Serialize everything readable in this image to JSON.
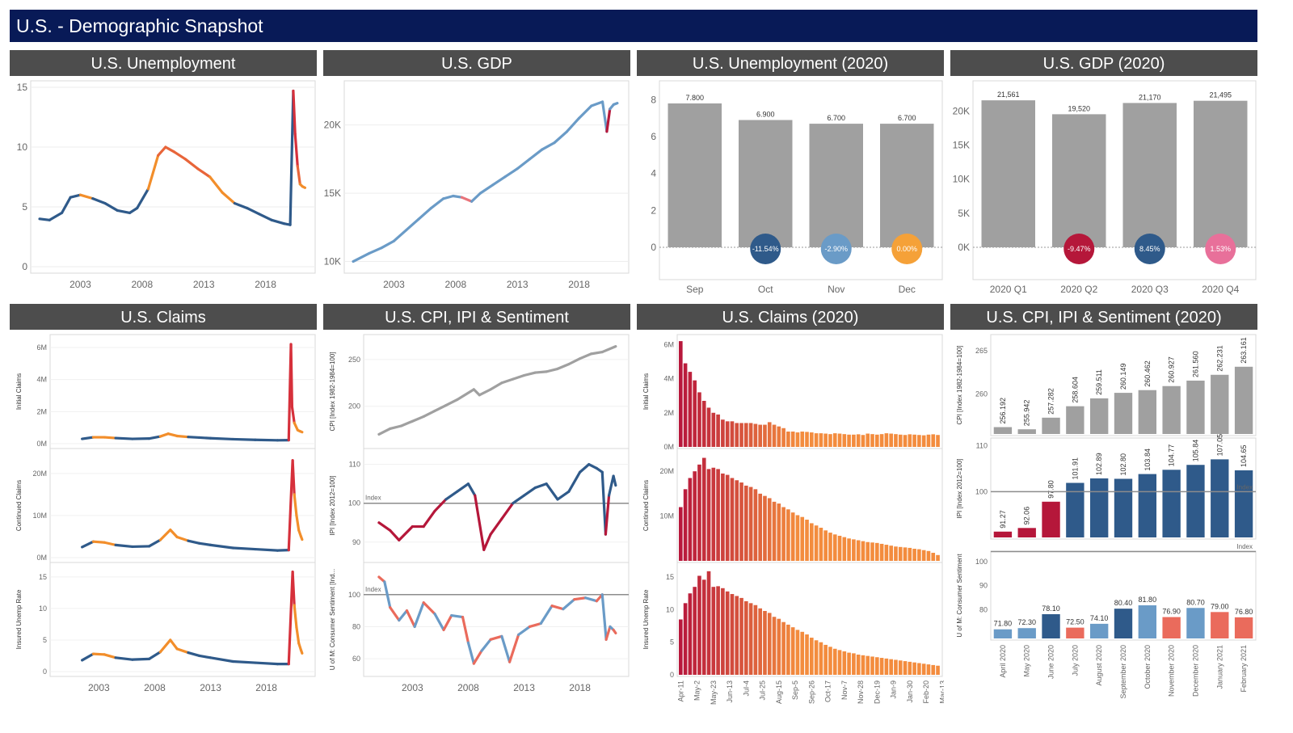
{
  "page_title": "U.S. - Demographic Snapshot",
  "colors": {
    "blue": "#2f5a8a",
    "orange": "#f28e2b",
    "red": "#d6303b",
    "crimson": "#b5173a",
    "grey": "#a0a0a0",
    "lightblue": "#6a9bc7",
    "salmon": "#ea6b5c",
    "pink": "#e8709a"
  },
  "panels": {
    "unemp": {
      "title": "U.S. Unemployment"
    },
    "gdp": {
      "title": "U.S. GDP"
    },
    "unemp2020": {
      "title": "U.S. Unemployment (2020)"
    },
    "gdp2020": {
      "title": "U.S. GDP (2020)"
    },
    "claims": {
      "title": "U.S. Claims"
    },
    "cpi": {
      "title": "U.S. CPI, IPI & Sentiment"
    },
    "claims2020": {
      "title": "U.S. Claims (2020)"
    },
    "cpi2020": {
      "title": "U.S. CPI, IPI & Sentiment (2020)"
    }
  },
  "chart_data": [
    {
      "id": "unemp",
      "type": "line",
      "title": "U.S. Unemployment",
      "ylim": [
        0,
        15
      ],
      "yticks": [
        "0",
        "5",
        "10",
        "15"
      ],
      "xticks": [
        "2003",
        "2008",
        "2013",
        "2018"
      ],
      "x": [
        1999.7,
        2000.5,
        2001.5,
        2002.2,
        2003.0,
        2004.0,
        2005.0,
        2006.0,
        2007.0,
        2007.6,
        2008.5,
        2009.3,
        2009.9,
        2010.6,
        2011.5,
        2012.5,
        2013.5,
        2014.5,
        2015.5,
        2016.5,
        2017.5,
        2018.5,
        2019.5,
        2020.0,
        2020.25,
        2020.4,
        2020.6,
        2020.8,
        2021.0,
        2021.2
      ],
      "y": [
        4.0,
        3.9,
        4.5,
        5.8,
        6.0,
        5.7,
        5.3,
        4.7,
        4.5,
        4.9,
        6.5,
        9.3,
        10.0,
        9.6,
        9.0,
        8.2,
        7.5,
        6.2,
        5.3,
        4.9,
        4.4,
        3.9,
        3.6,
        3.5,
        14.7,
        11.1,
        8.4,
        6.9,
        6.7,
        6.6
      ]
    },
    {
      "id": "gdp",
      "type": "line",
      "title": "U.S. GDP",
      "ylim": [
        9500,
        23000
      ],
      "yticks": [
        "10K",
        "15K",
        "20K"
      ],
      "xticks": [
        "2003",
        "2008",
        "2013",
        "2018"
      ],
      "x": [
        1999.7,
        2001,
        2002,
        2003,
        2004,
        2005,
        2006,
        2007,
        2007.8,
        2008.5,
        2009.3,
        2010,
        2011,
        2012,
        2013,
        2014,
        2015,
        2016,
        2017,
        2018,
        2019,
        2019.9,
        2020.25,
        2020.5,
        2020.8,
        2021.1
      ],
      "y": [
        10000,
        10600,
        11000,
        11500,
        12300,
        13100,
        13900,
        14600,
        14800,
        14700,
        14400,
        15000,
        15600,
        16200,
        16800,
        17500,
        18200,
        18700,
        19500,
        20500,
        21400,
        21700,
        19520,
        21170,
        21495,
        21600
      ]
    },
    {
      "id": "unemp2020",
      "type": "bar",
      "title": "U.S. Unemployment (2020)",
      "categories": [
        "Sep",
        "Oct",
        "Nov",
        "Dec"
      ],
      "values": [
        7.8,
        6.9,
        6.7,
        6.7
      ],
      "labels": [
        "7.800",
        "6.900",
        "6.700",
        "6.700"
      ],
      "changes": [
        "",
        "-11.54%",
        "-2.90%",
        "0.00%"
      ],
      "change_colors": [
        "",
        "#2f5a8a",
        "#6a9bc7",
        "#f5a138"
      ],
      "ylim": [
        0,
        8.5
      ],
      "yticks": [
        "0",
        "2",
        "4",
        "6",
        "8"
      ]
    },
    {
      "id": "gdp2020",
      "type": "bar",
      "title": "U.S. GDP (2020)",
      "categories": [
        "2020 Q1",
        "2020 Q2",
        "2020 Q3",
        "2020 Q4"
      ],
      "values": [
        21561,
        19520,
        21170,
        21495
      ],
      "labels": [
        "21,561",
        "19,520",
        "21,170",
        "21,495"
      ],
      "changes": [
        "",
        "-9.47%",
        "8.45%",
        "1.53%"
      ],
      "change_colors": [
        "",
        "#b5173a",
        "#2f5a8a",
        "#e8709a"
      ],
      "ylim": [
        0,
        23000
      ],
      "yticks": [
        "0K",
        "5K",
        "10K",
        "15K",
        "20K"
      ]
    },
    {
      "id": "claims",
      "type": "line",
      "title": "U.S. Claims",
      "xticks": [
        "2003",
        "2008",
        "2013",
        "2018"
      ],
      "subplots": [
        {
          "ylabel": "Initial Claims",
          "yticks": [
            "0M",
            "2M",
            "4M",
            "6M"
          ],
          "ylim": [
            0,
            6.3
          ],
          "x": [
            2001.5,
            2002.5,
            2003.5,
            2004.5,
            2006,
            2007.5,
            2008.5,
            2009.2,
            2010,
            2011,
            2012,
            2013,
            2015,
            2017,
            2019,
            2020.0,
            2020.2,
            2020.3,
            2020.5,
            2020.8,
            2021.0,
            2021.2
          ],
          "y": [
            0.3,
            0.4,
            0.4,
            0.35,
            0.3,
            0.32,
            0.45,
            0.62,
            0.48,
            0.42,
            0.38,
            0.34,
            0.28,
            0.24,
            0.21,
            0.22,
            6.2,
            2.3,
            1.3,
            0.85,
            0.78,
            0.72
          ]
        },
        {
          "ylabel": "Continued Claims",
          "yticks": [
            "0M",
            "10M",
            "20M"
          ],
          "ylim": [
            0,
            24
          ],
          "x": [
            2001.5,
            2002.5,
            2003.5,
            2004.5,
            2006,
            2007.5,
            2008.5,
            2009.4,
            2010,
            2011,
            2012,
            2013,
            2015,
            2017,
            2019,
            2020.0,
            2020.35,
            2020.5,
            2020.7,
            2020.9,
            2021.1,
            2021.2
          ],
          "y": [
            2.5,
            3.8,
            3.6,
            3.0,
            2.6,
            2.7,
            4.2,
            6.6,
            4.9,
            4.0,
            3.4,
            3.0,
            2.3,
            2.0,
            1.7,
            1.8,
            23.1,
            15.0,
            10.0,
            6.5,
            5.0,
            4.3
          ]
        },
        {
          "ylabel": "Insured Unemp Rate",
          "yticks": [
            "0",
            "5",
            "10",
            "15"
          ],
          "ylim": [
            0,
            16
          ],
          "x": [
            2001.5,
            2002.5,
            2003.5,
            2004.5,
            2006,
            2007.5,
            2008.5,
            2009.4,
            2010,
            2011,
            2012,
            2013,
            2015,
            2017,
            2019,
            2020.0,
            2020.35,
            2020.5,
            2020.7,
            2020.9,
            2021.1,
            2021.2
          ],
          "y": [
            1.8,
            2.8,
            2.7,
            2.2,
            1.9,
            2.0,
            3.1,
            5.0,
            3.6,
            3.0,
            2.5,
            2.2,
            1.6,
            1.4,
            1.2,
            1.2,
            15.8,
            10.5,
            7.0,
            4.5,
            3.4,
            2.9
          ]
        }
      ]
    },
    {
      "id": "cpi",
      "type": "line",
      "title": "U.S. CPI, IPI & Sentiment",
      "xticks": [
        "2003",
        "2008",
        "2013",
        "2018"
      ],
      "subplots": [
        {
          "ylabel": "CPI [Index 1982-1984=100]",
          "yticks": [
            "200",
            "250"
          ],
          "ylim": [
            160,
            268
          ],
          "x": [
            2000,
            2001,
            2002,
            2003,
            2004,
            2005,
            2006,
            2007,
            2008.5,
            2009,
            2010,
            2011,
            2012,
            2013,
            2014,
            2015,
            2016,
            2017,
            2018,
            2019,
            2020,
            2021.2
          ],
          "y": [
            170,
            176,
            179,
            184,
            189,
            195,
            201,
            207,
            218,
            212,
            218,
            225,
            229,
            233,
            236,
            237,
            240,
            245,
            251,
            256,
            258,
            264
          ]
        },
        {
          "ylabel": "IPI [Index 2012=100]",
          "yticks": [
            "90",
            "100",
            "110"
          ],
          "ylim": [
            86,
            112
          ],
          "index_line": 100,
          "index_label": "Index",
          "x": [
            2000,
            2001,
            2001.8,
            2003,
            2004,
            2005,
            2006,
            2007,
            2008,
            2008.6,
            2009.4,
            2010,
            2011,
            2012,
            2013,
            2014,
            2015,
            2016,
            2017,
            2018,
            2018.8,
            2019.5,
            2020.0,
            2020.3,
            2020.6,
            2021.0,
            2021.2
          ],
          "y": [
            95,
            93,
            90.5,
            94,
            94,
            98,
            101,
            103,
            105,
            102,
            88,
            92,
            96,
            100,
            102,
            104,
            105,
            101,
            103,
            108,
            110,
            109,
            108,
            92,
            102,
            107,
            104.6
          ]
        },
        {
          "ylabel": "U of M: Consumer Sentiment [Ind...",
          "yticks": [
            "60",
            "80",
            "100"
          ],
          "ylim": [
            52,
            115
          ],
          "index_line": 100,
          "index_label": "Index",
          "x": [
            2000,
            2000.5,
            2001,
            2001.8,
            2002.5,
            2003.2,
            2004,
            2005,
            2005.8,
            2006.5,
            2007.5,
            2008,
            2008.5,
            2009.2,
            2010,
            2011,
            2011.7,
            2012.5,
            2013.5,
            2014.5,
            2015.5,
            2016.5,
            2017.5,
            2018.5,
            2019.5,
            2020.0,
            2020.35,
            2020.7,
            2021.0,
            2021.2
          ],
          "y": [
            111,
            108,
            92,
            84,
            90,
            80,
            95,
            88,
            78,
            87,
            86,
            70,
            57,
            65,
            72,
            74,
            58,
            75,
            80,
            82,
            93,
            91,
            97,
            98,
            96,
            100,
            72,
            80,
            78,
            76
          ]
        }
      ]
    },
    {
      "id": "claims2020",
      "type": "bar",
      "title": "U.S. Claims (2020)",
      "xticks": [
        "Apr-11",
        "May-2",
        "May-23",
        "Jun-13",
        "Jul-4",
        "Jul-25",
        "Aug-15",
        "Sep-5",
        "Sep-26",
        "Oct-17",
        "Nov-7",
        "Nov-28",
        "Dec-19",
        "Jan-9",
        "Jan-30",
        "Feb-20",
        "Mar-13"
      ],
      "subplots": [
        {
          "ylabel": "Initial Claims",
          "yticks": [
            "0M",
            "2M",
            "4M",
            "6M"
          ],
          "ylim": [
            0,
            6.3
          ],
          "values": [
            6.2,
            4.9,
            4.4,
            3.9,
            3.2,
            2.7,
            2.3,
            2.0,
            1.9,
            1.6,
            1.5,
            1.5,
            1.4,
            1.4,
            1.4,
            1.4,
            1.35,
            1.3,
            1.3,
            1.45,
            1.3,
            1.2,
            1.1,
            0.9,
            0.9,
            0.85,
            0.9,
            0.88,
            0.85,
            0.8,
            0.8,
            0.78,
            0.75,
            0.8,
            0.78,
            0.75,
            0.72,
            0.72,
            0.74,
            0.7,
            0.78,
            0.75,
            0.72,
            0.75,
            0.8,
            0.78,
            0.75,
            0.72,
            0.7,
            0.74,
            0.72,
            0.7,
            0.68,
            0.72,
            0.74,
            0.7
          ]
        },
        {
          "ylabel": "Continued Claims",
          "yticks": [
            "10M",
            "20M"
          ],
          "ylim": [
            0,
            24
          ],
          "values": [
            12,
            16,
            18.5,
            20,
            21.5,
            23,
            20.5,
            20.8,
            20.5,
            19.5,
            19.2,
            18.5,
            18,
            17.5,
            16.8,
            16.5,
            16,
            15,
            14.5,
            14,
            13.2,
            12.8,
            12,
            11.5,
            10.8,
            10.2,
            9.8,
            9.2,
            8.4,
            7.9,
            7.4,
            6.8,
            6.3,
            5.9,
            5.6,
            5.3,
            5.0,
            4.8,
            4.6,
            4.4,
            4.2,
            4.1,
            4.0,
            3.8,
            3.6,
            3.4,
            3.2,
            3.1,
            3.0,
            2.9,
            2.7,
            2.6,
            2.4,
            2.2,
            1.8,
            1.3
          ]
        },
        {
          "ylabel": "Insured Unemp Rate",
          "yticks": [
            "0",
            "5",
            "10",
            "15"
          ],
          "ylim": [
            0,
            16.5
          ],
          "values": [
            8.5,
            11,
            12.5,
            13.5,
            15.2,
            14.6,
            15.9,
            13.5,
            13.6,
            13.3,
            12.8,
            12.4,
            12.1,
            11.8,
            11.3,
            11,
            10.7,
            10.2,
            9.8,
            9.5,
            8.9,
            8.6,
            8.1,
            7.7,
            7.3,
            6.9,
            6.6,
            6.2,
            5.7,
            5.3,
            5.0,
            4.6,
            4.3,
            4.0,
            3.8,
            3.6,
            3.4,
            3.3,
            3.1,
            3.0,
            2.9,
            2.8,
            2.7,
            2.6,
            2.5,
            2.4,
            2.3,
            2.2,
            2.1,
            2.0,
            1.9,
            1.8,
            1.7,
            1.6,
            1.5,
            1.4
          ]
        }
      ]
    },
    {
      "id": "cpi2020",
      "type": "bar",
      "title": "U.S. CPI, IPI & Sentiment (2020)",
      "categories": [
        "April 2020",
        "May 2020",
        "June 2020",
        "July 2020",
        "August 2020",
        "September 2020",
        "October 2020",
        "November 2020",
        "December 2020",
        "January 2021",
        "February 2021"
      ],
      "subplots": [
        {
          "ylabel": "CPI [Index 1982-1984=100]",
          "yticks": [
            "260",
            "265"
          ],
          "ylim": [
            255.4,
            266.5
          ],
          "values": [
            256.192,
            255.942,
            257.282,
            258.604,
            259.511,
            260.149,
            260.462,
            260.927,
            261.56,
            262.231,
            263.161
          ],
          "labels": [
            "256.192",
            "255.942",
            "257.282",
            "258.604",
            "259.511",
            "260.149",
            "260.462",
            "260.927",
            "261.560",
            "262.231",
            "263.161"
          ],
          "colors": [
            "grey",
            "grey",
            "grey",
            "grey",
            "grey",
            "grey",
            "grey",
            "grey",
            "grey",
            "grey",
            "grey"
          ]
        },
        {
          "ylabel": "IPI [Index 2012=100]",
          "yticks": [
            "100",
            "110"
          ],
          "ylim": [
            90,
            111
          ],
          "index_line": 100,
          "index_label": "Index",
          "values": [
            91.27,
            92.06,
            97.8,
            101.91,
            102.89,
            102.8,
            103.84,
            104.77,
            105.84,
            107.05,
            104.65
          ],
          "labels": [
            "91.27",
            "92.06",
            "97.80",
            "101.91",
            "102.89",
            "102.80",
            "103.84",
            "104.77",
            "105.84",
            "107.05",
            "104.65"
          ],
          "colors": [
            "crimson",
            "crimson",
            "crimson",
            "blue",
            "blue",
            "blue",
            "blue",
            "blue",
            "blue",
            "blue",
            "blue"
          ]
        },
        {
          "ylabel": "U of M: Consumer Sentiment",
          "yticks": [
            "80",
            "90",
            "100"
          ],
          "ylim": [
            68,
            103
          ],
          "index_line": 100,
          "index_label": "Index",
          "values": [
            71.8,
            72.3,
            78.1,
            72.5,
            74.1,
            80.4,
            81.8,
            76.9,
            80.7,
            79.0,
            76.8
          ],
          "labels": [
            "71.80",
            "72.30",
            "78.10",
            "72.50",
            "74.10",
            "80.40",
            "81.80",
            "76.90",
            "80.70",
            "79.00",
            "76.80"
          ],
          "colors": [
            "lightblue",
            "lightblue",
            "blue",
            "salmon",
            "lightblue",
            "blue",
            "lightblue",
            "salmon",
            "lightblue",
            "salmon",
            "salmon"
          ]
        }
      ]
    }
  ]
}
